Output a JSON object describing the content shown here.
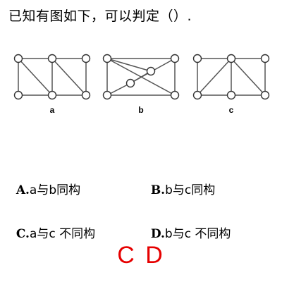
{
  "question": "已知有图如下，可以判定（）.",
  "graph_labels": [
    "a",
    "b",
    "c"
  ],
  "options": [
    {
      "letter": "A.",
      "text": "a与b同构"
    },
    {
      "letter": "B.",
      "text": "b与c同构"
    },
    {
      "letter": "C.",
      "text": "a与c 不同构"
    },
    {
      "letter": "D.",
      "text": "b与c 不同构"
    }
  ],
  "answer": "C D",
  "colors": {
    "answer": "#e60000",
    "edge": "#555555",
    "vertex_stroke": "#333333"
  }
}
